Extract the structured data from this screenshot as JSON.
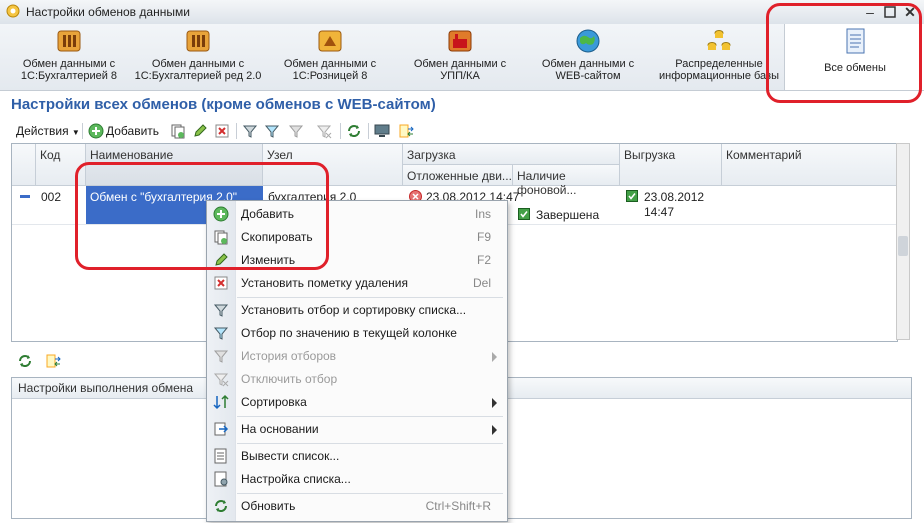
{
  "window": {
    "title": "Настройки обменов данными"
  },
  "nav": {
    "items": [
      {
        "label": "Обмен данными с 1С:Бухгалтерией 8",
        "icon": "exchange-icon"
      },
      {
        "label": "Обмен данными с 1С:Бухгалтерией ред 2.0",
        "icon": "exchange-icon"
      },
      {
        "label": "Обмен данными с 1С:Розницей 8",
        "icon": "exchange-icon"
      },
      {
        "label": "Обмен данными с УПП/КА",
        "icon": "factory-icon"
      },
      {
        "label": "Обмен данными с WEB-сайтом",
        "icon": "globe-icon"
      },
      {
        "label": "Распределенные информационные базы",
        "icon": "database-icon"
      },
      {
        "label": "Все обмены",
        "icon": "document-icon"
      }
    ]
  },
  "header": {
    "title": "Настройки всех обменов (кроме обменов с WEB-сайтом)"
  },
  "toolbar": {
    "actions_label": "Действия",
    "add_label": "Добавить"
  },
  "grid": {
    "columns": {
      "code": "Код",
      "name": "Наименование",
      "node": "Узел",
      "load": "Загрузка",
      "load_deferred": "Отложенные дви...",
      "load_background": "Наличие фоновой...",
      "unload": "Выгрузка",
      "comment": "Комментарий"
    },
    "rows": [
      {
        "code": "002",
        "name": "Обмен с \"бухгалтерия 2.0\"",
        "node": "бухгалтерия 2.0",
        "load_deferred": "23.08.2012 14:47",
        "load_background": "Завершена",
        "unload_date": "23.08.2012",
        "unload_time": "14:47",
        "comment": ""
      }
    ]
  },
  "bottom": {
    "panel_title": "Настройки выполнения обмена"
  },
  "context_menu": {
    "items": [
      {
        "label": "Добавить",
        "key": "Ins"
      },
      {
        "label": "Скопировать",
        "key": "F9"
      },
      {
        "label": "Изменить",
        "key": "F2"
      },
      {
        "label": "Установить пометку удаления",
        "key": "Del"
      },
      {
        "label": "Установить отбор и сортировку списка...",
        "key": ""
      },
      {
        "label": "Отбор по значению в текущей колонке",
        "key": ""
      },
      {
        "label": "История отборов",
        "key": ""
      },
      {
        "label": "Отключить отбор",
        "key": ""
      },
      {
        "label": "Сортировка",
        "key": ""
      },
      {
        "label": "На основании",
        "key": ""
      },
      {
        "label": "Вывести список...",
        "key": ""
      },
      {
        "label": "Настройка списка...",
        "key": ""
      },
      {
        "label": "Обновить",
        "key": "Ctrl+Shift+R"
      }
    ]
  },
  "colors": {
    "accent": "#2f5fa8",
    "annotation": "#e0202a",
    "selection": "#3b6cc8"
  }
}
